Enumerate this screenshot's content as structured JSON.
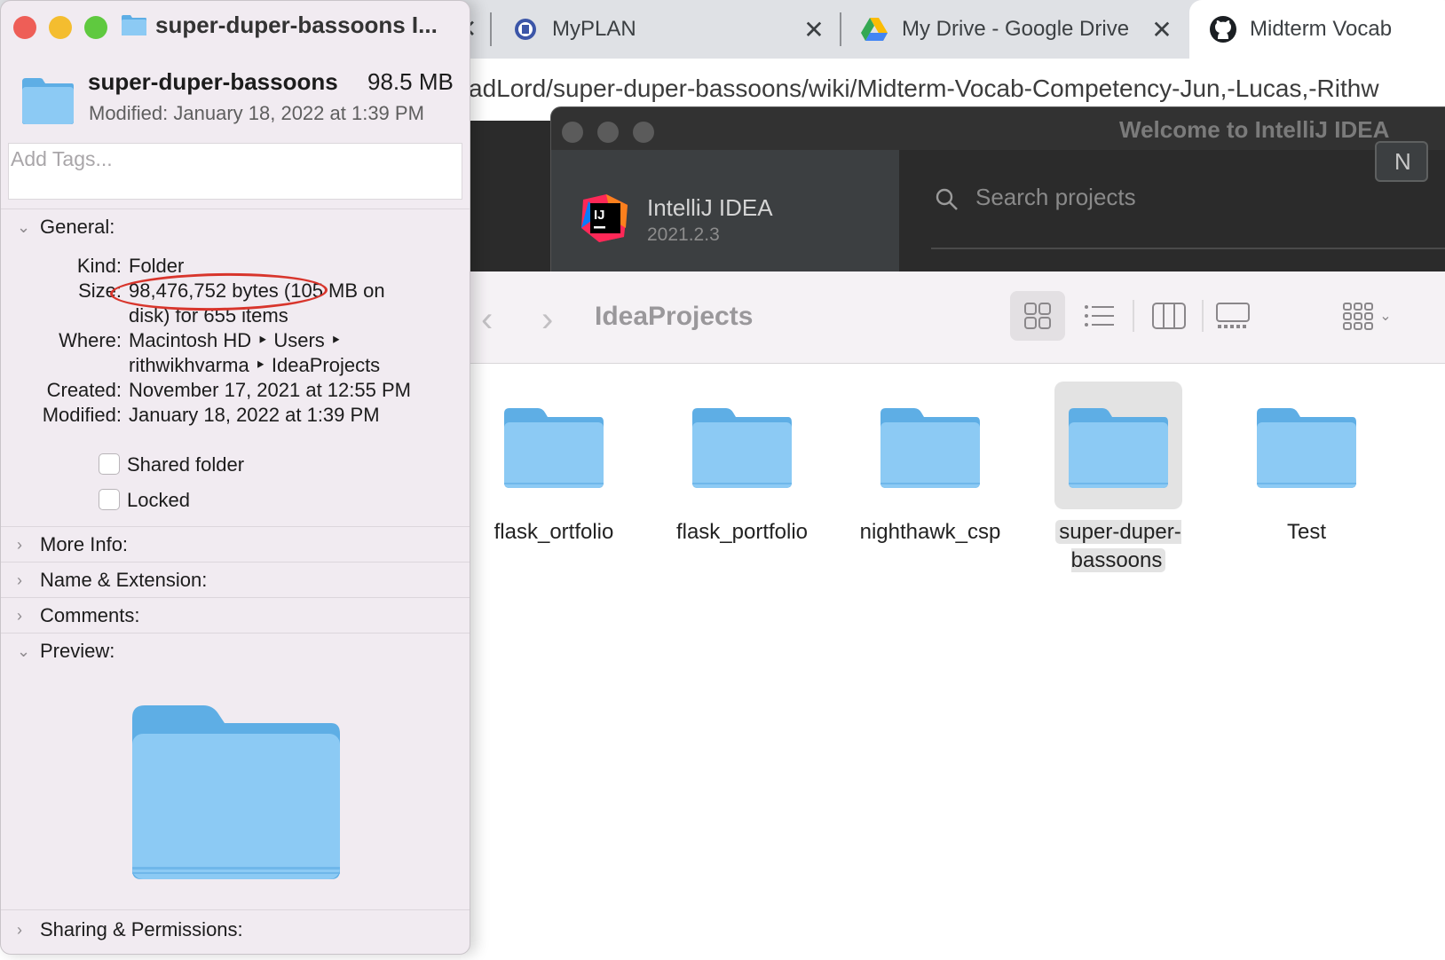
{
  "browser": {
    "tabs": [
      {
        "title": "MyPLAN"
      },
      {
        "title": "My Drive - Google Drive"
      },
      {
        "title": "Midterm Vocab"
      }
    ],
    "close_glyph": "✕",
    "url": "adLord/super-duper-bassoons/wiki/Midterm-Vocab-Competency-Jun,-Lucas,-Rithw"
  },
  "intellij": {
    "window_title": "Welcome to IntelliJ IDEA",
    "logo_text": "IJ",
    "product_name": "IntelliJ IDEA",
    "version": "2021.2.3",
    "search_placeholder": "Search projects",
    "new_button_label": "N"
  },
  "finder": {
    "title": "IdeaProjects",
    "back_glyph": "‹",
    "forward_glyph": "›",
    "selected_view": "icon",
    "items": [
      {
        "name": "flask_ortfolio",
        "selected": false
      },
      {
        "name": "flask_portfolio",
        "selected": false
      },
      {
        "name": "nighthawk_csp",
        "selected": false
      },
      {
        "name": "super-duper-\nbassoons",
        "selected": true
      },
      {
        "name": "Test",
        "selected": false
      }
    ]
  },
  "info": {
    "title": "super-duper-bassoons I...",
    "name": "super-duper-bassoons",
    "size_short": "98.5 MB",
    "modified_line": "Modified: January 18, 2022 at 1:39 PM",
    "tags_placeholder": "Add Tags...",
    "general": {
      "heading": "General:",
      "kind_label": "Kind:",
      "kind": "Folder",
      "size_label": "Size:",
      "size_line1": "98,476,752 bytes (105 MB on",
      "size_line2": "disk) for 655 items",
      "where_label": "Where:",
      "where_line1": "Macintosh HD ‣ Users ‣",
      "where_line2": "rithwikhvarma ‣ IdeaProjects",
      "created_label": "Created:",
      "created": "November 17, 2021 at 12:55 PM",
      "modified_label": "Modified:",
      "modified": "January 18, 2022 at 1:39 PM",
      "shared_label": "Shared folder",
      "locked_label": "Locked",
      "shared_checked": false,
      "locked_checked": false
    },
    "sections": {
      "more_info": "More Info:",
      "name_ext": "Name & Extension:",
      "comments": "Comments:",
      "preview": "Preview:",
      "sharing": "Sharing & Permissions:"
    },
    "annotation_color": "#d8352c"
  },
  "colors": {
    "folder_light": "#8ccaf4",
    "folder_dark": "#5eaee5",
    "traffic_red": "#ee5e57",
    "traffic_yellow": "#f4bd2f",
    "traffic_green": "#5fc93f"
  }
}
